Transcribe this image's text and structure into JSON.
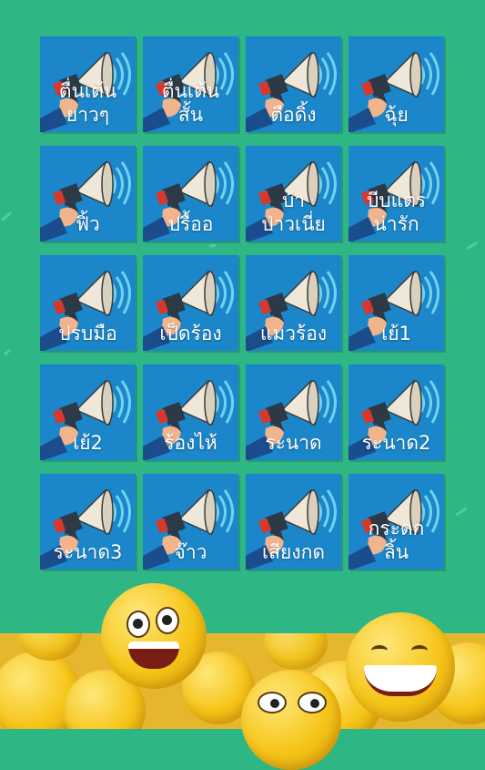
{
  "background_color": "#2fb685",
  "tile_color": "#1b86c9",
  "tiles": [
    {
      "label": "ตื่นเต้น\nยาวๆ",
      "icon": "megaphone-icon"
    },
    {
      "label": "ตื่นเต้น\nสั้น",
      "icon": "megaphone-icon"
    },
    {
      "label": "ตือดิ้ง",
      "icon": "megaphone-icon"
    },
    {
      "label": "ฉุ้ย",
      "icon": "megaphone-icon"
    },
    {
      "label": "ฟิ้ว",
      "icon": "megaphone-icon"
    },
    {
      "label": "ปรื้ออ",
      "icon": "megaphone-icon"
    },
    {
      "label": "บ้า\nป่าวเนี่ย",
      "icon": "megaphone-icon"
    },
    {
      "label": "บีบแตร\nน่ารัก",
      "icon": "megaphone-icon"
    },
    {
      "label": "ปรบมือ",
      "icon": "megaphone-icon"
    },
    {
      "label": "เป็ดร้อง",
      "icon": "megaphone-icon"
    },
    {
      "label": "แมวร้อง",
      "icon": "megaphone-icon"
    },
    {
      "label": "เย้1",
      "icon": "megaphone-icon"
    },
    {
      "label": "เย้2",
      "icon": "megaphone-icon"
    },
    {
      "label": "ร้องไห้",
      "icon": "megaphone-icon"
    },
    {
      "label": "ระนาด",
      "icon": "megaphone-icon"
    },
    {
      "label": "ระนาด2",
      "icon": "megaphone-icon"
    },
    {
      "label": "ระนาด3",
      "icon": "megaphone-icon"
    },
    {
      "label": "จ๊าว",
      "icon": "megaphone-icon"
    },
    {
      "label": "เสียงกด",
      "icon": "megaphone-icon"
    },
    {
      "label": "กระดก\nลิ้น",
      "icon": "megaphone-icon"
    }
  ],
  "footer_decoration": "smiley-emoji-pile"
}
